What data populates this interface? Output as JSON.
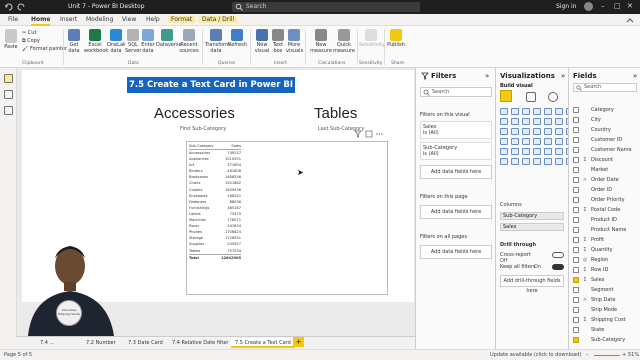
{
  "window": {
    "title": "Unit 7 - Power BI Desktop",
    "search_placeholder": "Search",
    "signin": "Sign in"
  },
  "menu": {
    "tabs": [
      "File",
      "Home",
      "Insert",
      "Modeling",
      "View",
      "Help",
      "Format",
      "Data / Drill"
    ],
    "active": "Home"
  },
  "ribbon": {
    "clipboard": {
      "paste": "Paste",
      "cut": "Cut",
      "copy": "Copy",
      "format_painter": "Format painter",
      "group": "Clipboard"
    },
    "data": {
      "get_data": "Get data",
      "excel": "Excel workbook",
      "hub": "OneLake data hub",
      "sql": "SQL Server",
      "enter": "Enter data",
      "dataverse": "Dataverse",
      "recent": "Recent sources",
      "group": "Data"
    },
    "queries": {
      "transform": "Transform data",
      "refresh": "Refresh",
      "group": "Queries"
    },
    "insert": {
      "new_visual": "New visual",
      "text_box": "Text box",
      "more_visuals": "More visuals",
      "group": "Insert"
    },
    "calculations": {
      "new_measure": "New measure",
      "quick_measure": "Quick measure",
      "group": "Calculations"
    },
    "sensitivity": {
      "label": "Sensitivity",
      "group": "Sensitivity"
    },
    "share": {
      "publish": "Publish",
      "group": "Share"
    }
  },
  "canvas": {
    "banner": "7.5 Create a Text Card in Power BI",
    "card1": {
      "value": "Accessories",
      "label": "First Sub-Category"
    },
    "card2": {
      "value": "Tables",
      "label": "Last Sub-Category"
    },
    "table": {
      "headers": [
        "Sub-Category",
        "Sales"
      ],
      "rows": [
        [
          "Accessories",
          "749237"
        ],
        [
          "Appliances",
          "1010551"
        ],
        [
          "Art",
          "371894"
        ],
        [
          "Binders",
          "481808"
        ],
        [
          "Bookcases",
          "1488556"
        ],
        [
          "Chairs",
          "1501882"
        ],
        [
          "Copiers",
          "1509436"
        ],
        [
          "Envelopes",
          "168242"
        ],
        [
          "Fasteners",
          "88036"
        ],
        [
          "Furnishings",
          "385187"
        ],
        [
          "Labels",
          "73379"
        ],
        [
          "Machines",
          "778071"
        ],
        [
          "Paper",
          "241834"
        ],
        [
          "Phones",
          "1706824"
        ],
        [
          "Storage",
          "1126551"
        ],
        [
          "Supplies",
          "243927"
        ],
        [
          "Tables",
          "757034"
        ]
      ],
      "total_label": "Total",
      "total_value": "12642905"
    }
  },
  "page_tabs": [
    "7.4 ...",
    "7.2 Number",
    "7.3 Date Card",
    "7.4 Relative Date filter",
    "7.5 Create a Text Card"
  ],
  "active_page": "7.5 Create a Text Card",
  "status": {
    "page": "Page 5 of 5",
    "zoom": "51%",
    "update": "Update available (click to download)"
  },
  "filters": {
    "title": "Filters",
    "search_placeholder": "Search",
    "on_visual": "Filters on this visual",
    "cards": [
      {
        "name": "Sales",
        "value": "is (All)"
      },
      {
        "name": "Sub-Category",
        "value": "is (All)"
      }
    ],
    "add": "Add data fields here",
    "on_page": "Filters on this page",
    "on_all": "Filters on all pages"
  },
  "visualizations": {
    "title": "Visualizations",
    "build": "Build visual",
    "columns_label": "Columns",
    "columns": [
      "Sub-Category",
      "Sales"
    ],
    "drill_title": "Drill through",
    "cross_report": "Cross-report",
    "cross_report_state": "Off",
    "keep_filters": "Keep all filters",
    "keep_filters_state": "On",
    "add_drill": "Add drill-through fields here"
  },
  "fields": {
    "title": "Fields",
    "search_placeholder": "Search",
    "items": [
      {
        "name": "Category",
        "checked": false,
        "type": ""
      },
      {
        "name": "City",
        "checked": false,
        "type": ""
      },
      {
        "name": "Country",
        "checked": false,
        "type": ""
      },
      {
        "name": "Customer ID",
        "checked": false,
        "type": ""
      },
      {
        "name": "Customer Name",
        "checked": false,
        "type": ""
      },
      {
        "name": "Discount",
        "checked": false,
        "type": "Σ"
      },
      {
        "name": "Market",
        "checked": false,
        "type": ""
      },
      {
        "name": "Order Date",
        "checked": false,
        "type": ">"
      },
      {
        "name": "Order ID",
        "checked": false,
        "type": ""
      },
      {
        "name": "Order Priority",
        "checked": false,
        "type": ""
      },
      {
        "name": "Postal Code",
        "checked": false,
        "type": "Σ"
      },
      {
        "name": "Product ID",
        "checked": false,
        "type": ""
      },
      {
        "name": "Product Name",
        "checked": false,
        "type": ""
      },
      {
        "name": "Profit",
        "checked": false,
        "type": "Σ"
      },
      {
        "name": "Quantity",
        "checked": false,
        "type": "Σ"
      },
      {
        "name": "Region",
        "checked": false,
        "type": "◎"
      },
      {
        "name": "Row ID",
        "checked": false,
        "type": "Σ"
      },
      {
        "name": "Sales",
        "checked": true,
        "type": "Σ"
      },
      {
        "name": "Segment",
        "checked": false,
        "type": ""
      },
      {
        "name": "Ship Date",
        "checked": false,
        "type": ">"
      },
      {
        "name": "Ship Mode",
        "checked": false,
        "type": ""
      },
      {
        "name": "Shipping Cost",
        "checked": false,
        "type": "Σ"
      },
      {
        "name": "State",
        "checked": false,
        "type": ""
      },
      {
        "name": "Sub-Category",
        "checked": true,
        "type": ""
      }
    ]
  },
  "logo_text": "Industries Helping Hands",
  "colors": {
    "accent": "#f2c811",
    "banner": "#1565c0",
    "titlebar": "#1f1f1f"
  }
}
